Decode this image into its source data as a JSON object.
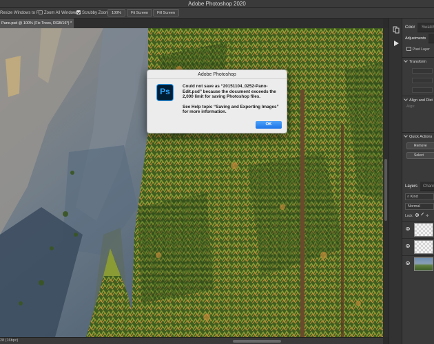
{
  "app": {
    "title": "Adobe Photoshop 2020"
  },
  "options_bar": {
    "resize_windows": "Resize Windows to Fit",
    "zoom_all_windows": "Zoom All Windows",
    "scrubby_zoom": "Scrubby Zoom",
    "zoom_percent": "100%",
    "fit_screen": "Fit Screen",
    "fill_screen": "Fill Screen"
  },
  "document": {
    "tab_label": "Pano.psd @ 100% (Fix Trees, RGB/16*) *",
    "close_glyph": "×",
    "status_text": "28 (16bpc)"
  },
  "panels": {
    "tab_color": "Color",
    "tab_swatches": "Swatch",
    "tab_adjustments": "Adjustments",
    "pixel_layer": "Pixel Layer",
    "transform": "Transform",
    "align": "Align and Dist",
    "align_sub": "Align:",
    "quick_actions": "Quick Actions",
    "remove_btn": "Remove",
    "select_btn": "Select",
    "tab_layers": "Layers",
    "tab_channels": "Channe",
    "kind_filter": "Kind",
    "blend_mode": "Normal",
    "lock_label": "Lock:"
  },
  "dialog": {
    "title": "Adobe Photoshop",
    "icon_text": "Ps",
    "message": "Could not save as “20151104_0252-Pano-Edit.psd” because the document exceeds the 2,000 limit for saving Photoshop files.",
    "help": "See Help topic “Saving and Exporting Images” for more information.",
    "ok_label": "OK"
  },
  "colors": {
    "accent": "#1c74e8",
    "ps_brand": "#31a8ff",
    "ps_bg": "#001e36"
  }
}
